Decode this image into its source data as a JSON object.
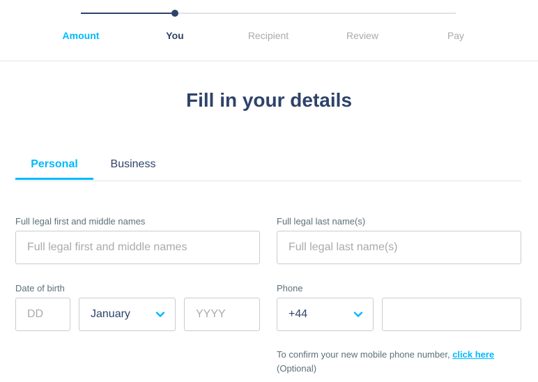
{
  "stepper": {
    "progress_percent": 25,
    "steps": [
      {
        "label": "Amount",
        "state": "done"
      },
      {
        "label": "You",
        "state": "active"
      },
      {
        "label": "Recipient",
        "state": "pending"
      },
      {
        "label": "Review",
        "state": "pending"
      },
      {
        "label": "Pay",
        "state": "pending"
      }
    ]
  },
  "page": {
    "title": "Fill in your details"
  },
  "tabs": {
    "personal": "Personal",
    "business": "Business",
    "selected": "Personal"
  },
  "form": {
    "first_names": {
      "label": "Full legal first and middle names",
      "placeholder": "Full legal first and middle names",
      "value": ""
    },
    "last_name": {
      "label": "Full legal last name(s)",
      "placeholder": "Full legal last name(s)",
      "value": ""
    },
    "dob": {
      "label": "Date of birth",
      "day_placeholder": "DD",
      "month_value": "January",
      "year_placeholder": "YYYY"
    },
    "phone": {
      "label": "Phone",
      "country_code": "+44",
      "number_value": ""
    },
    "help": {
      "text": "To confirm your new mobile phone number, ",
      "link": "click here ",
      "optional": "(Optional)"
    }
  },
  "colors": {
    "accent": "#00b9ff",
    "navy": "#2e4369",
    "muted": "#a8aaac",
    "border": "#c9cbce"
  },
  "icons": {
    "dropdown": "chevron-down-icon"
  }
}
